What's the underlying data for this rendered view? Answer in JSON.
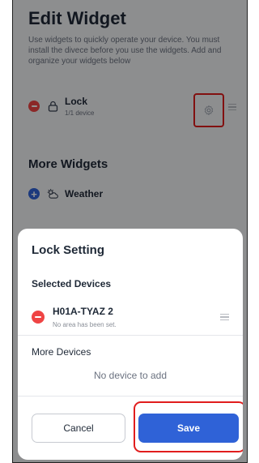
{
  "page": {
    "title": "Edit Widget",
    "description": "Use widgets to quickly operate your device. You must install the divece before you use the widgets. Add and organize your widgets below"
  },
  "active_widgets": [
    {
      "name": "Lock",
      "subtitle": "1/1 device",
      "icon": "lock-icon"
    }
  ],
  "more_widgets": {
    "title": "More Widgets",
    "items": [
      {
        "name": "Weather",
        "icon": "weather-icon"
      }
    ]
  },
  "sheet": {
    "title": "Lock Setting",
    "selected_title": "Selected Devices",
    "devices": [
      {
        "name": "H01A-TYAZ 2",
        "area": "No area has been set."
      }
    ],
    "more_title": "More Devices",
    "empty_text": "No device to add",
    "cancel_label": "Cancel",
    "save_label": "Save"
  },
  "colors": {
    "accent": "#2f62d7",
    "remove": "#ef4444",
    "highlight": "#e11d1d"
  }
}
